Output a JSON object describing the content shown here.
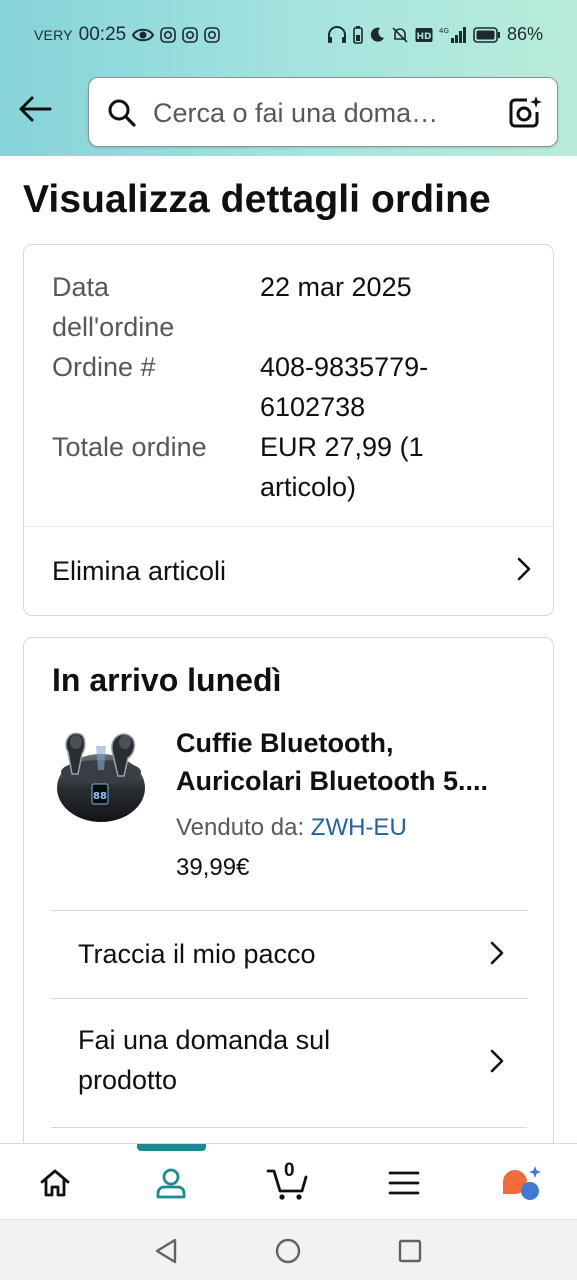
{
  "status_bar": {
    "carrier": "VERY",
    "time": "00:25",
    "battery": "86%"
  },
  "search": {
    "placeholder": "Cerca o fai una doma…"
  },
  "page": {
    "title": "Visualizza dettagli ordine"
  },
  "order_summary": {
    "date_label_line1": "Data",
    "date_label_line2": "dell'ordine",
    "date_value": "22 mar 2025",
    "order_label": "Ordine #",
    "order_value_line1": "408-9835779-",
    "order_value_line2": "6102738",
    "total_label": "Totale ordine",
    "total_value_line1": "EUR 27,99 (1",
    "total_value_line2": "articolo)",
    "delete_items_label": "Elimina articoli"
  },
  "shipment": {
    "title": "In arrivo lunedì",
    "product_title_line1": "Cuffie Bluetooth,",
    "product_title_line2": "Auricolari Bluetooth 5....",
    "seller_label": "Venduto da: ",
    "seller_name": "ZWH-EU",
    "price": "39,99€",
    "actions": [
      {
        "label": "Traccia il mio pacco"
      },
      {
        "label_line1": "Fai una domanda sul",
        "label_line2": "prodotto"
      }
    ]
  },
  "bottom_nav": {
    "cart_count": "0",
    "active": "account"
  },
  "colors": {
    "header_gradient_start": "#86d3d9",
    "header_gradient_end": "#b9ecd9",
    "link": "#2162a1",
    "accent": "#1b8a94"
  }
}
